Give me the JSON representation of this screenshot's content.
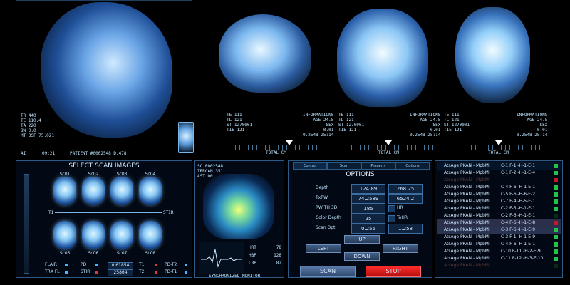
{
  "top_left": {
    "readouts": [
      "TR 440",
      "TE 110.4",
      "TA 220",
      "BW 0.0",
      "MT DSF 75.021"
    ],
    "ai": "AI",
    "time": "09:21",
    "patient": "PATIENT #0002548 D.478"
  },
  "top_scans": [
    {
      "left_text": [
        "TE 111",
        "TL 121",
        "ST 1270001",
        "TIE 121"
      ],
      "right_text": [
        "INFORMATIONS",
        "AGE 24.5",
        "SEX",
        "0.01"
      ],
      "bottom_right": "0.2548 25:14",
      "scale_label": "TOTAL CM"
    },
    {
      "left_text": [
        "TE 111",
        "TL 121",
        "ST 1270001",
        "TIE 121"
      ],
      "right_text": [
        "INFORMATIONS",
        "AGE 24.5",
        "SEX",
        "0.01"
      ],
      "bottom_right": "0.2548 25:14",
      "scale_label": "TOTAL CM"
    },
    {
      "left_text": [
        "TE 111",
        "TL 121",
        "ST 1270001",
        "TIE 121"
      ],
      "right_text": [
        "INFORMATIONS",
        "AGE 24.5",
        "SEX",
        "0.01"
      ],
      "bottom_right": "0.2548 25:14",
      "scale_label": "TOTAL CM"
    }
  ],
  "select_scan": {
    "title": "SELECT SCAN IMAGES",
    "top_labels": [
      "Sc01",
      "Sc02",
      "Sc03",
      "Sc04"
    ],
    "bottom_labels": [
      "Sc05",
      "Sc06",
      "Sc07",
      "Sc08"
    ],
    "axis_left": "T1",
    "axis_right": "STIR",
    "legend": [
      {
        "name": "FLAIR",
        "val": ""
      },
      {
        "name": "PD",
        "val": "0.61854"
      },
      {
        "name": "T1",
        "val": ""
      },
      {
        "name": "PD-T2",
        "val": ""
      },
      {
        "name": "TRX FL",
        "val": ""
      },
      {
        "name": "STIR",
        "val": "25864"
      },
      {
        "name": "T2",
        "val": ""
      },
      {
        "name": "PD-T1",
        "val": ""
      }
    ]
  },
  "vitals": {
    "header": [
      "SC 0002548",
      "TRRCAN 351",
      "AST 00"
    ],
    "hrt_label": "HRT",
    "hrt": "78",
    "hbp_label": "HBP",
    "hbp": "128",
    "lbp_label": "LBP",
    "lbp": "82",
    "footer": "SYNCHRONIZED MONITOR"
  },
  "options": {
    "tabs": [
      "Control",
      "Scan",
      "Property",
      "Options"
    ],
    "title": "OPTIONS",
    "rows": [
      {
        "label": "Depth",
        "v1": "124.89",
        "v2": "268.25"
      },
      {
        "label": "TxRW",
        "v1": "74.2589",
        "v2": "6524.2"
      },
      {
        "label": "RW TH 3D",
        "v1": "185",
        "v2": "HR"
      },
      {
        "label": "Color Depth",
        "v1": "25",
        "v2": "ToHR"
      },
      {
        "label": "Scan Opt",
        "v1": "0.256",
        "v2": "1.258"
      }
    ],
    "up": "UP",
    "left": "LEFT",
    "right": "RIGHT",
    "down": "DOWN",
    "scan": "SCAN",
    "stop": "STOP"
  },
  "list_panel": {
    "rows": [
      {
        "name": "AtsAge PKAN - MpbMi",
        "code": "C-1 F-1 -H-1-E-1",
        "color": "#25c24a"
      },
      {
        "name": "AtsAge PKAN - MpbMi",
        "code": "C-1 F-2 -H-1-E-4",
        "color": "#25c24a"
      },
      {
        "name": "AtsAge PKAN - MpbMi",
        "code": "",
        "color": "#c21a2a"
      },
      {
        "name": "AtsAge PKAN - MpbMi",
        "code": "C-4 F-6 -H-1-E-1",
        "color": "#25c24a"
      },
      {
        "name": "AtsAge PKAN - MpbMi",
        "code": "C-5 F-6 -H-6-E-2",
        "color": "#25c24a"
      },
      {
        "name": "AtsAge PKAN - MpbMi",
        "code": "C-7 F-4 -H-5-E-1",
        "color": "#25c24a"
      },
      {
        "name": "AtsAge PKAN - MpbMi",
        "code": "C-2 F-5 -H-1-E-1",
        "color": "#25c24a"
      },
      {
        "name": "AtsAge PKAN - MpbMi",
        "code": "C-2 F-6 -H-1-E-1",
        "color": "#0b2a12"
      },
      {
        "name": "AtsAge PKAN - MpbMi",
        "code": "C-4 F-6 -H-1-E-8",
        "color": "#c21a2a"
      },
      {
        "name": "AtsAge PKAN - MpbMi",
        "code": "C-3 F-6 -H-1-E-9",
        "color": "#25c24a"
      },
      {
        "name": "AtsAge PKAN - MpbMi",
        "code": "C-3 F-1 -H-1-E-9",
        "color": "#25c24a"
      },
      {
        "name": "AtsAge PKAN - MpbMi",
        "code": "C-4 F-6 -H-1-E-1",
        "color": "#25c24a"
      },
      {
        "name": "AtsAge PKAN - MpbMi",
        "code": "C-10 F-11 -H-2-E-9",
        "color": "#25c24a"
      },
      {
        "name": "AtsAge PKAN - MpbMi",
        "code": "C-11 F-12 -H-3-E-10",
        "color": "#25c24a"
      },
      {
        "name": "AtsAge PKAN - MpbMi",
        "code": "",
        "color": "#0b2a12"
      }
    ]
  }
}
